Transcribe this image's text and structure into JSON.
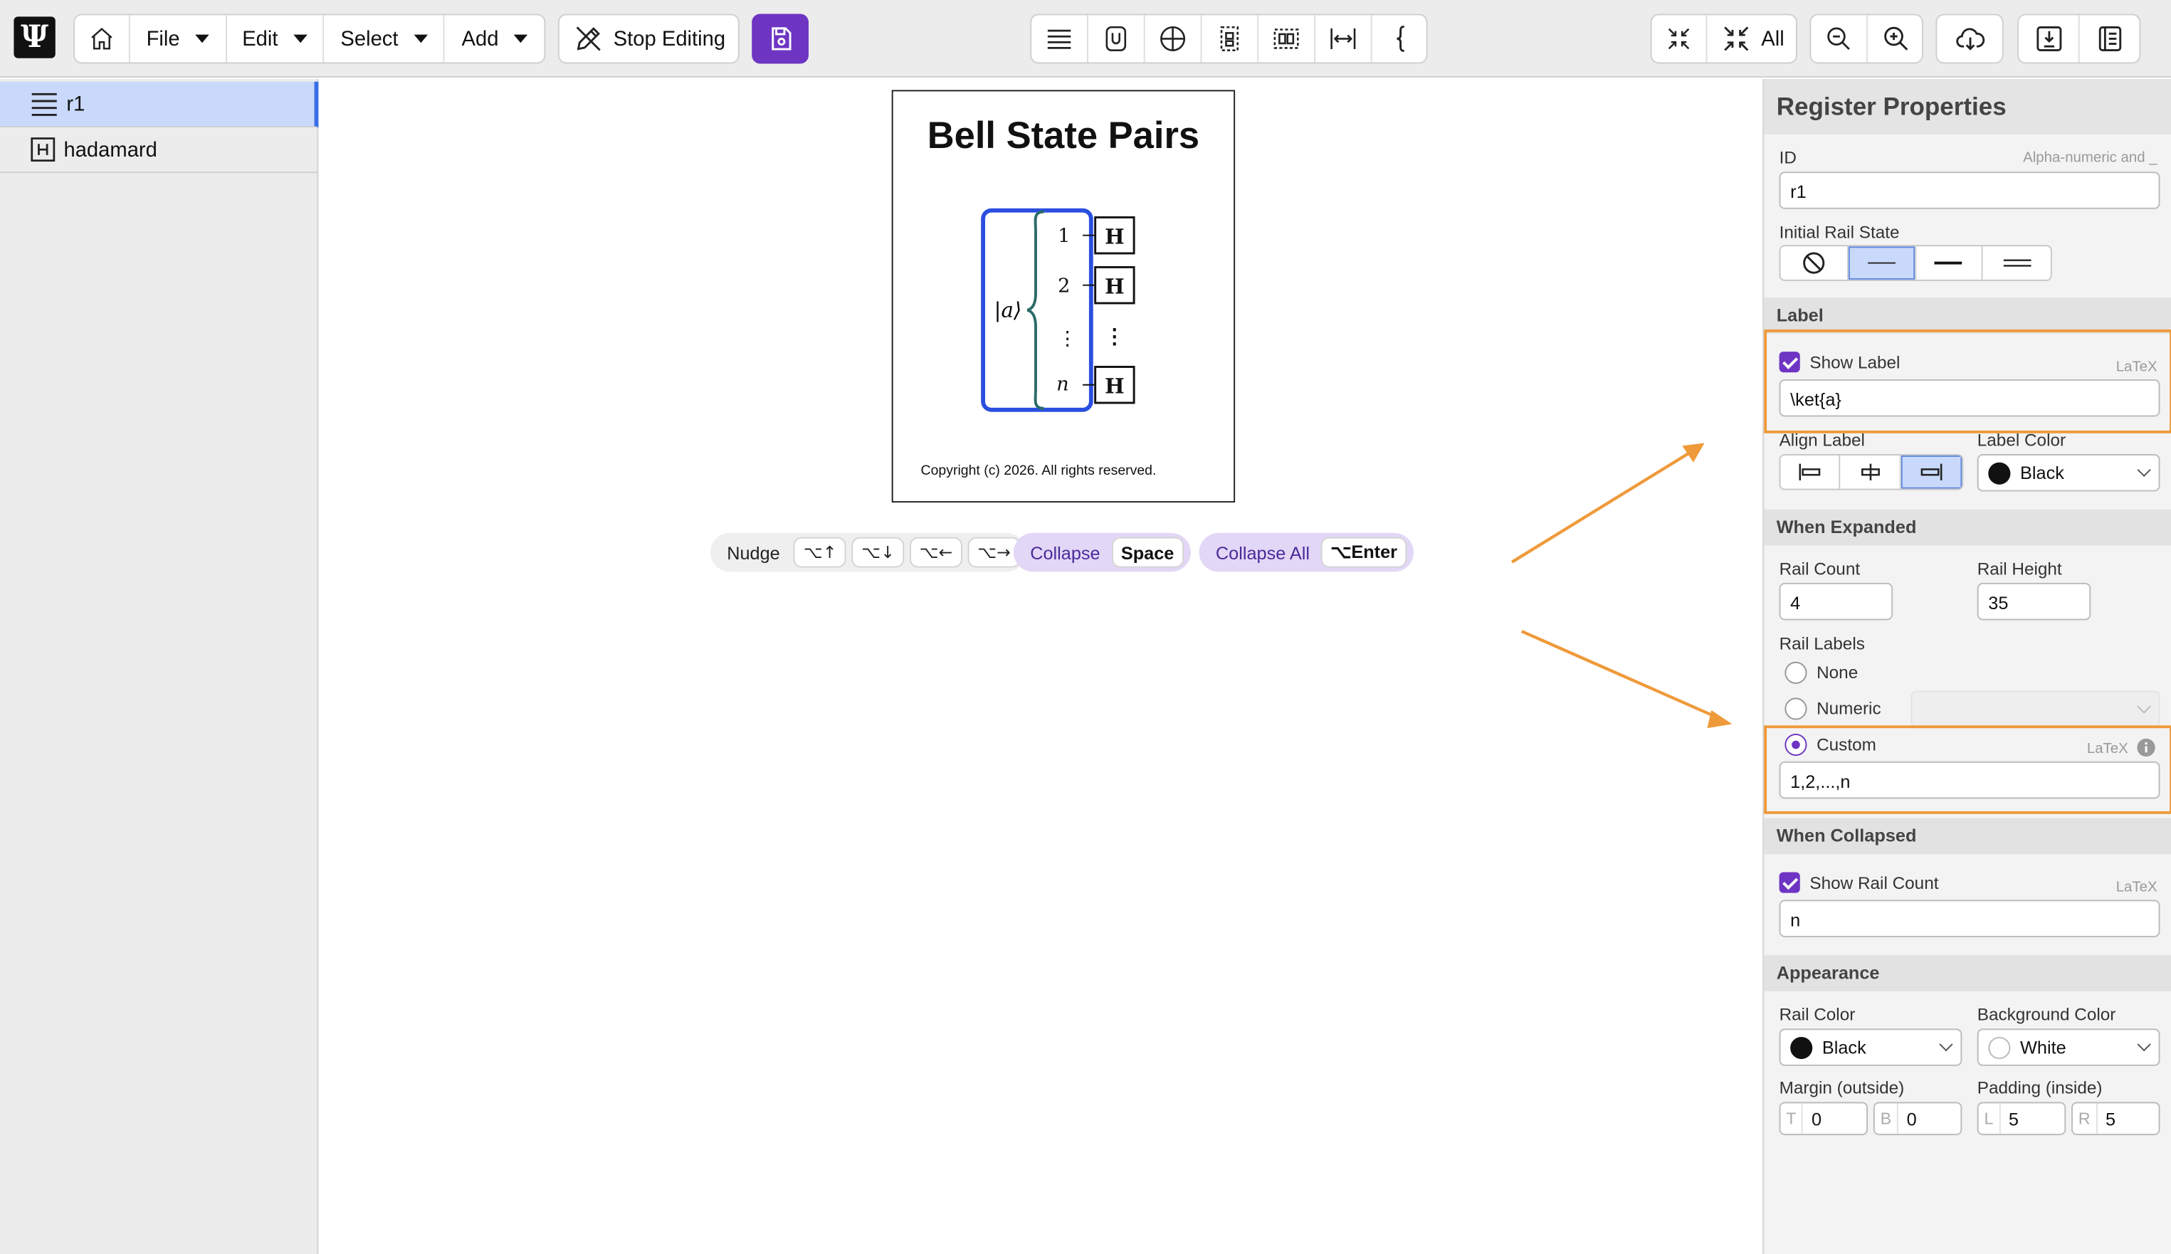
{
  "toolbar": {
    "logo": "Ψ",
    "menus": {
      "file": "File",
      "edit": "Edit",
      "select": "Select",
      "add": "Add"
    },
    "stop_editing": "Stop Editing",
    "all_label": "All",
    "icons": [
      "home-icon",
      "pencil-off-icon",
      "save-icon",
      "register-icon",
      "measure-icon",
      "target-icon",
      "group-icon",
      "ungroup-icon",
      "stretch-icon",
      "brace-icon",
      "collapse-icon",
      "collapse-all-icon",
      "zoom-out-icon",
      "zoom-in-icon",
      "cloud-download-icon",
      "code-icon",
      "notebook-icon"
    ]
  },
  "sidebar": {
    "items": [
      {
        "label": "r1",
        "icon": "register-icon",
        "selected": true
      },
      {
        "label": "hadamard",
        "icon": "hadamard-gate-icon",
        "selected": false
      }
    ]
  },
  "canvas": {
    "doc_title": "Bell State Pairs",
    "ket_label": "|a⟩",
    "rail_labels": [
      "1",
      "2",
      "⋮",
      "n"
    ],
    "gate_label": "H",
    "vdots": "⋮",
    "copyright": "Copyright (c) 2026. All rights reserved."
  },
  "shortcuts": {
    "nudge": "Nudge",
    "nudge_keys": [
      "⌥↑",
      "⌥↓",
      "⌥←",
      "⌥→"
    ],
    "collapse": "Collapse",
    "collapse_key": "Space",
    "collapse_all": "Collapse All",
    "collapse_all_key": "⌥Enter"
  },
  "panel": {
    "title": "Register Properties",
    "id_label": "ID",
    "id_hint": "Alpha-numeric and _",
    "id_value": "r1",
    "initial_rail_state": "Initial Rail State",
    "sections": {
      "label": "Label",
      "when_expanded": "When Expanded",
      "when_collapsed": "When Collapsed",
      "appearance": "Appearance"
    },
    "show_label": "Show Label",
    "latex_hint": "LaTeX",
    "label_value": "\\ket{a}",
    "align_label": "Align Label",
    "label_color": "Label Color",
    "label_color_value": "Black",
    "rail_count": "Rail Count",
    "rail_count_value": "4",
    "rail_height": "Rail Height",
    "rail_height_value": "35",
    "rail_labels": "Rail Labels",
    "rail_label_options": {
      "none": "None",
      "numeric": "Numeric",
      "custom": "Custom"
    },
    "custom_value": "1,2,...,n",
    "show_rail_count": "Show Rail Count",
    "collapsed_value": "n",
    "rail_color": "Rail Color",
    "rail_color_value": "Black",
    "background_color": "Background Color",
    "background_color_value": "White",
    "margin": "Margin (outside)",
    "padding": "Padding (inside)",
    "margin_t_prefix": "T",
    "margin_t": "0",
    "margin_b_prefix": "B",
    "margin_b": "0",
    "padding_l_prefix": "L",
    "padding_l": "5",
    "padding_r_prefix": "R",
    "padding_r": "5"
  },
  "colors": {
    "accent": "#6e35c3",
    "selection": "#c9d9fb",
    "highlight": "#ef9a3a",
    "register_border": "#2a4fe0"
  }
}
